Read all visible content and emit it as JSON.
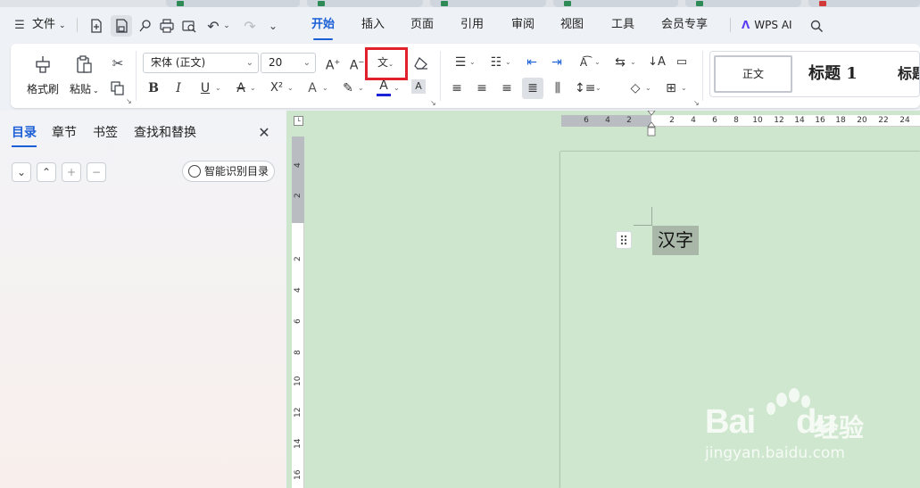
{
  "menubar": {
    "file_label": "文件",
    "tabs": [
      "开始",
      "插入",
      "页面",
      "引用",
      "审阅",
      "视图",
      "工具",
      "会员专享"
    ],
    "wps_ai_label": "WPS AI"
  },
  "ribbon": {
    "format_painter_label": "格式刷",
    "paste_label": "粘贴",
    "font_name": "宋体 (正文)",
    "font_size": "20",
    "style_normal": "正文",
    "style_heading1": "标题 1",
    "style_heading_cut": "标题"
  },
  "nav": {
    "tabs": [
      "目录",
      "章节",
      "书签",
      "查找和替换"
    ],
    "smart_toc_label": "智能识别目录"
  },
  "ruler": {
    "h_numbers": [
      "6",
      "4",
      "2",
      "2",
      "4",
      "6",
      "8",
      "10",
      "12",
      "14",
      "16",
      "18",
      "20",
      "22",
      "24"
    ],
    "v_numbers": [
      "4",
      "2",
      "2",
      "4",
      "6",
      "8",
      "10",
      "12",
      "14",
      "16"
    ]
  },
  "document": {
    "selected_text": "汉字"
  },
  "watermark": {
    "brand": "Bai",
    "brand2": "du",
    "cn": "经验",
    "url": "jingyan.baidu.com"
  },
  "colors": {
    "accent": "#1a5fd6",
    "highlight_box": "#e0202a",
    "page_bg": "#cfe7cf",
    "font_color_bar": "#1a24d6"
  }
}
